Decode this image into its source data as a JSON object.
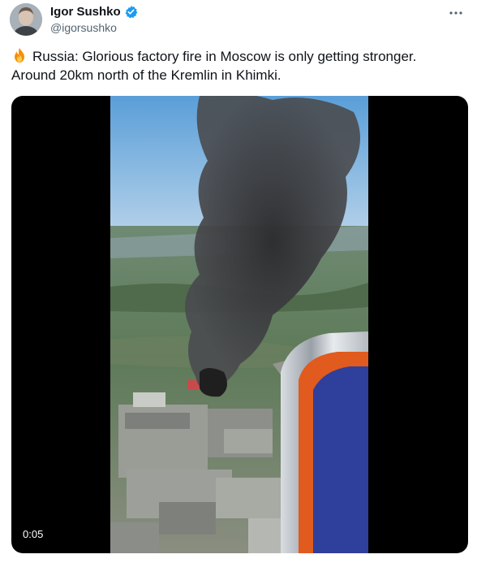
{
  "tweet": {
    "author_name": "Igor Sushko",
    "handle": "@igorsushko",
    "text_line1": "Russia: Glorious factory fire in Moscow is only getting stronger.",
    "text_line2": "Around 20km north of the Kremlin in Khimki.",
    "emoji": "fire-emoji"
  },
  "media": {
    "duration": "0:05"
  },
  "icons": {
    "verified": "verified-badge-icon",
    "more": "more-options-icon"
  },
  "colors": {
    "verified_blue": "#1d9bf0",
    "text_primary": "#0f1419",
    "text_secondary": "#536471",
    "media_background": "#000000"
  }
}
